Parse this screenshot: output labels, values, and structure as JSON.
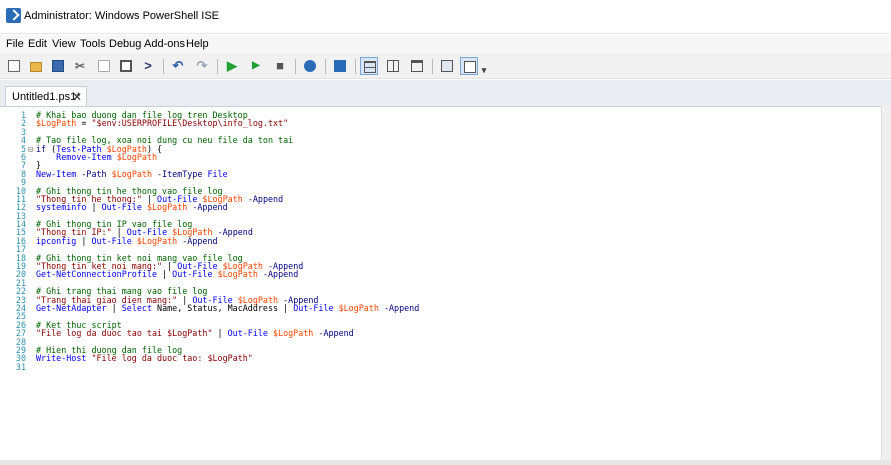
{
  "window": {
    "title": "Administrator: Windows PowerShell ISE",
    "icon": "powershell-icon"
  },
  "menubar": {
    "items": [
      "File",
      "Edit",
      "View",
      "Tools",
      "Debug",
      "Add-ons",
      "Help"
    ]
  },
  "toolbar": {
    "buttons": [
      {
        "name": "new-file-icon",
        "glyph": ""
      },
      {
        "name": "open-folder-icon",
        "glyph": ""
      },
      {
        "name": "save-icon",
        "glyph": ""
      },
      {
        "name": "cut-icon",
        "glyph": "✂"
      },
      {
        "name": "copy-icon",
        "glyph": ""
      },
      {
        "name": "paste-icon",
        "glyph": ""
      },
      {
        "name": "clear-console-icon",
        "glyph": ">"
      },
      {
        "name": "undo-icon",
        "glyph": "↶"
      },
      {
        "name": "redo-icon",
        "glyph": "↷"
      },
      {
        "name": "run-script-icon",
        "glyph": "▶"
      },
      {
        "name": "run-selection-icon",
        "glyph": "▶"
      },
      {
        "name": "stop-icon",
        "glyph": "■"
      },
      {
        "name": "remote-powershell-icon",
        "glyph": ""
      },
      {
        "name": "powershell-console-icon",
        "glyph": ""
      },
      {
        "name": "show-script-pane-top-icon",
        "glyph": ""
      },
      {
        "name": "show-script-pane-right-icon",
        "glyph": ""
      },
      {
        "name": "show-script-pane-maximized-icon",
        "glyph": ""
      },
      {
        "name": "show-command-window-icon",
        "glyph": ""
      },
      {
        "name": "show-command-addon-icon",
        "glyph": ""
      },
      {
        "name": "customize-toolbar-icon",
        "glyph": "▾"
      }
    ]
  },
  "tabs": [
    {
      "label": "Untitled1.ps1*",
      "close": "✕"
    }
  ],
  "colors": {
    "comment": "#006400",
    "string": "#8b0000",
    "variable": "#ff4500",
    "command": "#0000ff",
    "parameter": "#000080",
    "linenumber": "#2b91af",
    "keyword": "#00008b",
    "accent_blue": "#2b6cb8"
  },
  "editor": {
    "lines": [
      {
        "n": "1",
        "fold": "",
        "segs": [
          [
            "comment",
            "# Khai bao duong dan file log tren Desktop"
          ]
        ]
      },
      {
        "n": "2",
        "fold": "",
        "segs": [
          [
            "variable",
            "$LogPath"
          ],
          [
            "plain",
            " = "
          ],
          [
            "string",
            "\"$env:USERPROFILE\\Desktop\\info_log.txt\""
          ]
        ]
      },
      {
        "n": "3",
        "fold": "",
        "segs": []
      },
      {
        "n": "4",
        "fold": "",
        "segs": [
          [
            "comment",
            "# Tao file log, xoa noi dung cu neu file da ton tai"
          ]
        ]
      },
      {
        "n": "5",
        "fold": "⊟",
        "segs": [
          [
            "keyword",
            "if"
          ],
          [
            "plain",
            " ("
          ],
          [
            "command",
            "Test-Path"
          ],
          [
            "plain",
            " "
          ],
          [
            "variable",
            "$LogPath"
          ],
          [
            "plain",
            ") {"
          ]
        ]
      },
      {
        "n": "6",
        "fold": "",
        "segs": [
          [
            "plain",
            "    "
          ],
          [
            "command",
            "Remove-Item"
          ],
          [
            "plain",
            " "
          ],
          [
            "variable",
            "$LogPath"
          ]
        ]
      },
      {
        "n": "7",
        "fold": "",
        "segs": [
          [
            "plain",
            "}"
          ]
        ]
      },
      {
        "n": "8",
        "fold": "",
        "segs": [
          [
            "command",
            "New-Item"
          ],
          [
            "plain",
            " "
          ],
          [
            "parameter",
            "-Path"
          ],
          [
            "plain",
            " "
          ],
          [
            "variable",
            "$LogPath"
          ],
          [
            "plain",
            " "
          ],
          [
            "parameter",
            "-ItemType"
          ],
          [
            "plain",
            " "
          ],
          [
            "command",
            "File"
          ]
        ]
      },
      {
        "n": "9",
        "fold": "",
        "segs": []
      },
      {
        "n": "10",
        "fold": "",
        "segs": [
          [
            "comment",
            "# Ghi thong tin he thong vao file log"
          ]
        ]
      },
      {
        "n": "11",
        "fold": "",
        "segs": [
          [
            "string",
            "\"Thong tin he thong:\""
          ],
          [
            "plain",
            " | "
          ],
          [
            "command",
            "Out-File"
          ],
          [
            "plain",
            " "
          ],
          [
            "variable",
            "$LogPath"
          ],
          [
            "plain",
            " "
          ],
          [
            "parameter",
            "-Append"
          ]
        ]
      },
      {
        "n": "12",
        "fold": "",
        "segs": [
          [
            "command",
            "systeminfo"
          ],
          [
            "plain",
            " | "
          ],
          [
            "command",
            "Out-File"
          ],
          [
            "plain",
            " "
          ],
          [
            "variable",
            "$LogPath"
          ],
          [
            "plain",
            " "
          ],
          [
            "parameter",
            "-Append"
          ]
        ]
      },
      {
        "n": "13",
        "fold": "",
        "segs": []
      },
      {
        "n": "14",
        "fold": "",
        "segs": [
          [
            "comment",
            "# Ghi thong tin IP vao file log"
          ]
        ]
      },
      {
        "n": "15",
        "fold": "",
        "segs": [
          [
            "string",
            "\"Thong tin IP:\""
          ],
          [
            "plain",
            " | "
          ],
          [
            "command",
            "Out-File"
          ],
          [
            "plain",
            " "
          ],
          [
            "variable",
            "$LogPath"
          ],
          [
            "plain",
            " "
          ],
          [
            "parameter",
            "-Append"
          ]
        ]
      },
      {
        "n": "16",
        "fold": "",
        "segs": [
          [
            "command",
            "ipconfig"
          ],
          [
            "plain",
            " | "
          ],
          [
            "command",
            "Out-File"
          ],
          [
            "plain",
            " "
          ],
          [
            "variable",
            "$LogPath"
          ],
          [
            "plain",
            " "
          ],
          [
            "parameter",
            "-Append"
          ]
        ]
      },
      {
        "n": "17",
        "fold": "",
        "segs": []
      },
      {
        "n": "18",
        "fold": "",
        "segs": [
          [
            "comment",
            "# Ghi thong tin ket noi mang vao file log"
          ]
        ]
      },
      {
        "n": "19",
        "fold": "",
        "segs": [
          [
            "string",
            "\"Thong tin ket noi mang:\""
          ],
          [
            "plain",
            " | "
          ],
          [
            "command",
            "Out-File"
          ],
          [
            "plain",
            " "
          ],
          [
            "variable",
            "$LogPath"
          ],
          [
            "plain",
            " "
          ],
          [
            "parameter",
            "-Append"
          ]
        ]
      },
      {
        "n": "20",
        "fold": "",
        "segs": [
          [
            "command",
            "Get-NetConnectionProfile"
          ],
          [
            "plain",
            " | "
          ],
          [
            "command",
            "Out-File"
          ],
          [
            "plain",
            " "
          ],
          [
            "variable",
            "$LogPath"
          ],
          [
            "plain",
            " "
          ],
          [
            "parameter",
            "-Append"
          ]
        ]
      },
      {
        "n": "21",
        "fold": "",
        "segs": []
      },
      {
        "n": "22",
        "fold": "",
        "segs": [
          [
            "comment",
            "# Ghi trang thai mang vao file log"
          ]
        ]
      },
      {
        "n": "23",
        "fold": "",
        "segs": [
          [
            "string",
            "\"Trang thai giao dien mang:\""
          ],
          [
            "plain",
            " | "
          ],
          [
            "command",
            "Out-File"
          ],
          [
            "plain",
            " "
          ],
          [
            "variable",
            "$LogPath"
          ],
          [
            "plain",
            " "
          ],
          [
            "parameter",
            "-Append"
          ]
        ]
      },
      {
        "n": "24",
        "fold": "",
        "segs": [
          [
            "command",
            "Get-NetAdapter"
          ],
          [
            "plain",
            " | "
          ],
          [
            "command",
            "Select"
          ],
          [
            "plain",
            " Name, Status, MacAddress | "
          ],
          [
            "command",
            "Out-File"
          ],
          [
            "plain",
            " "
          ],
          [
            "variable",
            "$LogPath"
          ],
          [
            "plain",
            " "
          ],
          [
            "parameter",
            "-Append"
          ]
        ]
      },
      {
        "n": "25",
        "fold": "",
        "segs": []
      },
      {
        "n": "26",
        "fold": "",
        "segs": [
          [
            "comment",
            "# Ket thuc script"
          ]
        ]
      },
      {
        "n": "27",
        "fold": "",
        "segs": [
          [
            "string",
            "\"File log da duoc tao tai $LogPath\""
          ],
          [
            "plain",
            " | "
          ],
          [
            "command",
            "Out-File"
          ],
          [
            "plain",
            " "
          ],
          [
            "variable",
            "$LogPath"
          ],
          [
            "plain",
            " "
          ],
          [
            "parameter",
            "-Append"
          ]
        ]
      },
      {
        "n": "28",
        "fold": "",
        "segs": []
      },
      {
        "n": "29",
        "fold": "",
        "segs": [
          [
            "comment",
            "# Hien thi duong dan file log"
          ]
        ]
      },
      {
        "n": "30",
        "fold": "",
        "segs": [
          [
            "command",
            "Write-Host"
          ],
          [
            "plain",
            " "
          ],
          [
            "string",
            "\"File log da duoc tao: $LogPath\""
          ]
        ]
      },
      {
        "n": "31",
        "fold": "",
        "segs": []
      }
    ]
  }
}
